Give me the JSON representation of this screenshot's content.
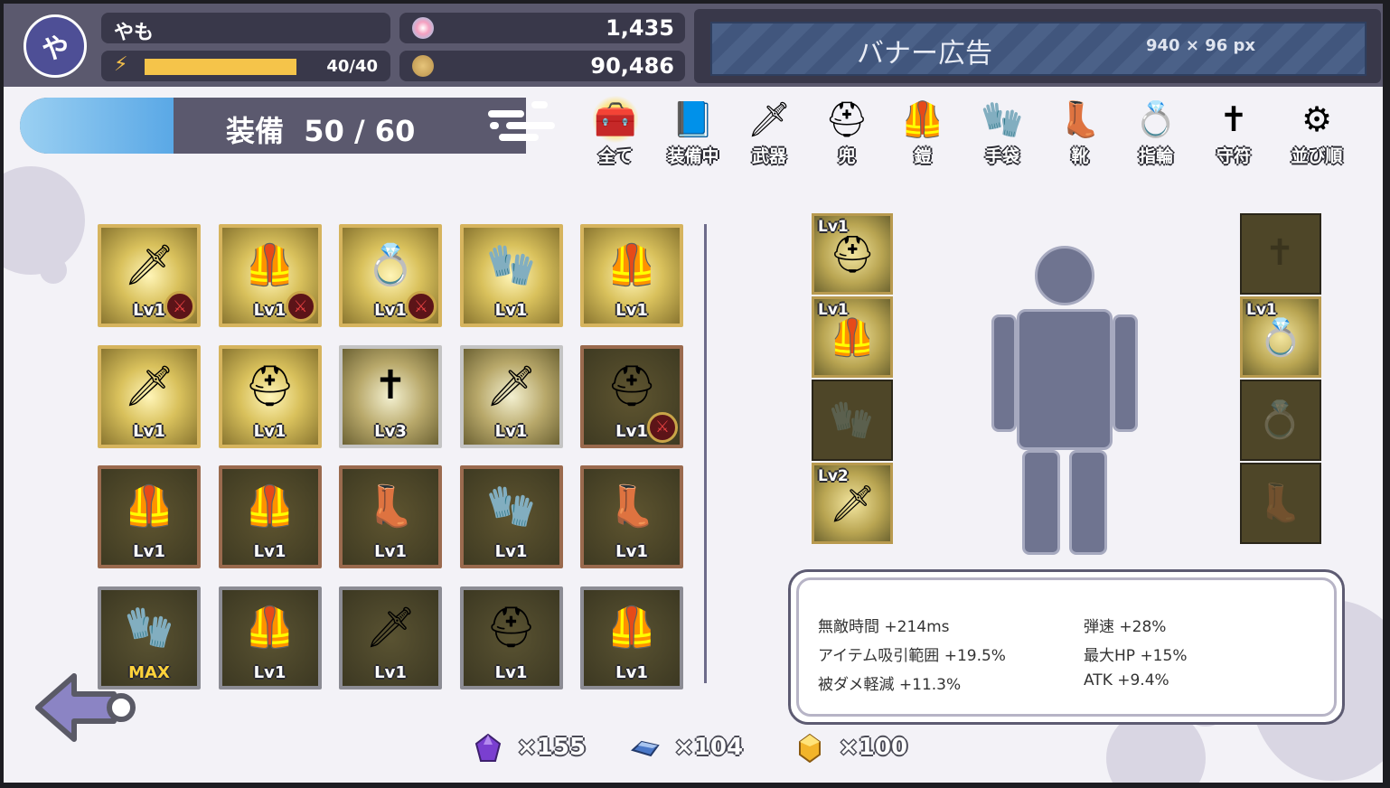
{
  "player": {
    "avatar_initial": "や",
    "name": "やも",
    "stamina_text": "40/40",
    "stamina_fraction": 1.0
  },
  "currency": {
    "gems": "1,435",
    "coins": "90,486"
  },
  "banner": {
    "title": "バナー広告",
    "size": "940 × 96 px"
  },
  "equip_header": {
    "label": "装備",
    "count": "50 / 60"
  },
  "tabs": [
    {
      "label": "全て",
      "icon": "treasure-chest-icon",
      "glyph": "🧰"
    },
    {
      "label": "装備中",
      "icon": "book-icon",
      "glyph": "📘"
    },
    {
      "label": "武器",
      "icon": "dagger-icon",
      "glyph": "🗡"
    },
    {
      "label": "兜",
      "icon": "helmet-icon",
      "glyph": "⛑"
    },
    {
      "label": "鎧",
      "icon": "armor-icon",
      "glyph": "🦺"
    },
    {
      "label": "手袋",
      "icon": "gauntlet-icon",
      "glyph": "🧤"
    },
    {
      "label": "靴",
      "icon": "boots-icon",
      "glyph": "👢"
    },
    {
      "label": "指輪",
      "icon": "ring-icon",
      "glyph": "💍"
    },
    {
      "label": "守符",
      "icon": "amulet-icon",
      "glyph": "✝"
    },
    {
      "label": "並び順",
      "icon": "gear-icon",
      "glyph": "⚙"
    }
  ],
  "inventory": [
    {
      "type": "dagger",
      "glyph": "🗡",
      "level": "Lv1",
      "frame": "gold",
      "equipped": true
    },
    {
      "type": "armor",
      "glyph": "🦺",
      "level": "Lv1",
      "frame": "gold",
      "equipped": true
    },
    {
      "type": "ring",
      "glyph": "💍",
      "level": "Lv1",
      "frame": "gold",
      "equipped": true
    },
    {
      "type": "gauntlet",
      "glyph": "🧤",
      "level": "Lv1",
      "frame": "gold",
      "equipped": false
    },
    {
      "type": "armor",
      "glyph": "🦺",
      "level": "Lv1",
      "frame": "gold",
      "equipped": false
    },
    {
      "type": "dagger",
      "glyph": "🗡",
      "level": "Lv1",
      "frame": "gold",
      "equipped": false
    },
    {
      "type": "helmet",
      "glyph": "⛑",
      "level": "Lv1",
      "frame": "gold",
      "equipped": false
    },
    {
      "type": "amulet",
      "glyph": "✝",
      "level": "Lv3",
      "frame": "silver",
      "equipped": false
    },
    {
      "type": "dagger",
      "glyph": "🗡",
      "level": "Lv1",
      "frame": "silver",
      "equipped": false
    },
    {
      "type": "helmet",
      "glyph": "⛑",
      "level": "Lv1",
      "frame": "bronze",
      "equipped": true
    },
    {
      "type": "armor",
      "glyph": "🦺",
      "level": "Lv1",
      "frame": "bronze",
      "equipped": false
    },
    {
      "type": "armor",
      "glyph": "🦺",
      "level": "Lv1",
      "frame": "bronze",
      "equipped": false
    },
    {
      "type": "boots",
      "glyph": "👢",
      "level": "Lv1",
      "frame": "bronze",
      "equipped": false
    },
    {
      "type": "gauntlet",
      "glyph": "🧤",
      "level": "Lv1",
      "frame": "bronze",
      "equipped": false
    },
    {
      "type": "boots",
      "glyph": "👢",
      "level": "Lv1",
      "frame": "bronze",
      "equipped": false
    },
    {
      "type": "gauntlet",
      "glyph": "🧤",
      "level": "MAX",
      "frame": "steel",
      "equipped": false
    },
    {
      "type": "armor",
      "glyph": "🦺",
      "level": "Lv1",
      "frame": "steel",
      "equipped": false
    },
    {
      "type": "dagger",
      "glyph": "🗡",
      "level": "Lv1",
      "frame": "steel",
      "equipped": false
    },
    {
      "type": "helmet",
      "glyph": "⛑",
      "level": "Lv1",
      "frame": "steel",
      "equipped": false
    },
    {
      "type": "armor",
      "glyph": "🦺",
      "level": "Lv1",
      "frame": "steel",
      "equipped": false
    }
  ],
  "equipped_left": [
    {
      "slot": "helmet",
      "glyph": "⛑",
      "level": "Lv1",
      "filled": true
    },
    {
      "slot": "armor",
      "glyph": "🦺",
      "level": "Lv1",
      "filled": true
    },
    {
      "slot": "gauntlet",
      "glyph": "🧤",
      "level": "",
      "filled": false
    },
    {
      "slot": "dagger",
      "glyph": "🗡",
      "level": "Lv2",
      "filled": true
    }
  ],
  "equipped_right": [
    {
      "slot": "amulet",
      "glyph": "✝",
      "level": "",
      "filled": false
    },
    {
      "slot": "ring",
      "glyph": "💍",
      "level": "Lv1",
      "filled": true
    },
    {
      "slot": "ring",
      "glyph": "💍",
      "level": "",
      "filled": false
    },
    {
      "slot": "boots",
      "glyph": "👢",
      "level": "",
      "filled": false
    }
  ],
  "stats": {
    "left": [
      "無敵時間 +214ms",
      "アイテム吸引範囲 +19.5%",
      "被ダメ軽減 +11.3%"
    ],
    "right": [
      "弾速 +28%",
      "最大HP +15%",
      "ATK +9.4%"
    ]
  },
  "resources": [
    {
      "icon": "purple-crystal-icon",
      "value": "×155",
      "color": "#7a3fd0"
    },
    {
      "icon": "blue-ingot-icon",
      "value": "×104",
      "color": "#4a78c8"
    },
    {
      "icon": "gold-crystal-icon",
      "value": "×100",
      "color": "#f2b42a"
    }
  ]
}
